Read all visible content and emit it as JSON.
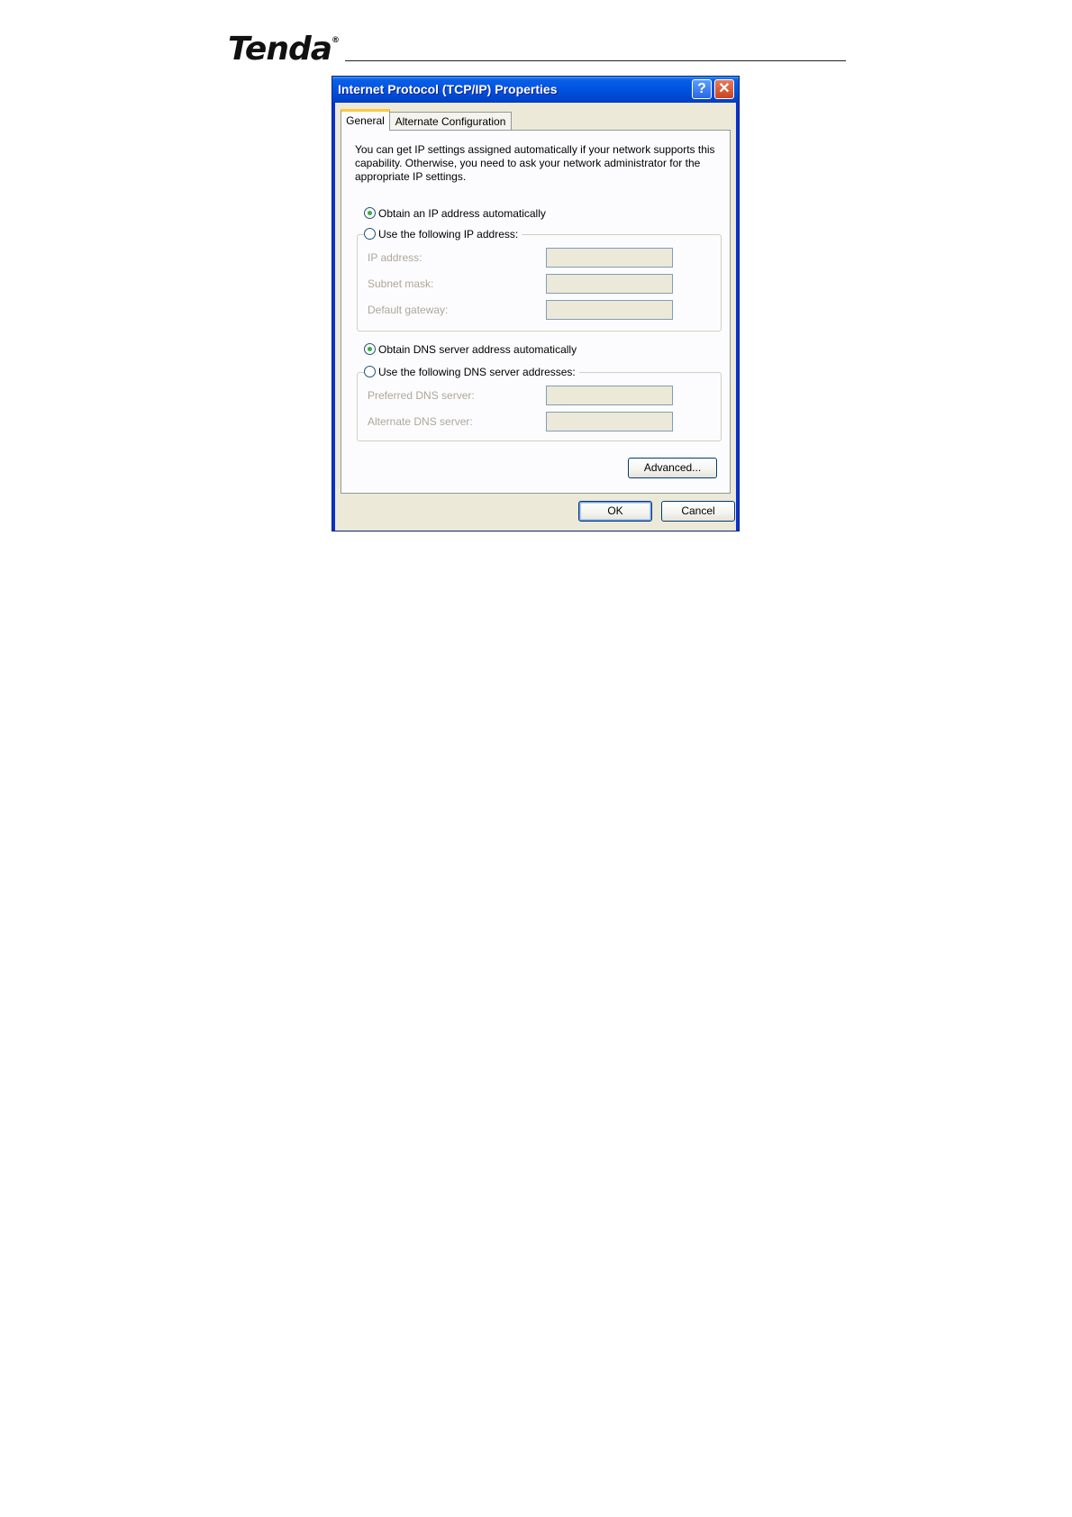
{
  "page": {
    "brand": "Tenda",
    "brand_mark": "®"
  },
  "dialog": {
    "title": "Internet Protocol (TCP/IP) Properties",
    "help_glyph": "?",
    "close_glyph": "✕",
    "tabs": [
      {
        "label": "General",
        "selected": true
      },
      {
        "label": "Alternate Configuration",
        "selected": false
      }
    ],
    "description": "You can get IP settings assigned automatically if your network supports this capability. Otherwise, you need to ask your network administrator for the appropriate IP settings.",
    "ip_options": {
      "auto": {
        "label": "Obtain an IP address automatically",
        "checked": true
      },
      "manual": {
        "label": "Use the following IP address:",
        "checked": false
      }
    },
    "ip_fields": [
      {
        "label": "IP address:",
        "value": ""
      },
      {
        "label": "Subnet mask:",
        "value": ""
      },
      {
        "label": "Default gateway:",
        "value": ""
      }
    ],
    "dns_options": {
      "auto": {
        "label": "Obtain DNS server address automatically",
        "checked": true
      },
      "manual": {
        "label": "Use the following DNS server addresses:",
        "checked": false
      }
    },
    "dns_fields": [
      {
        "label": "Preferred DNS server:",
        "value": ""
      },
      {
        "label": "Alternate DNS server:",
        "value": ""
      }
    ],
    "buttons": {
      "advanced": "Advanced...",
      "ok": "OK",
      "cancel": "Cancel"
    }
  }
}
